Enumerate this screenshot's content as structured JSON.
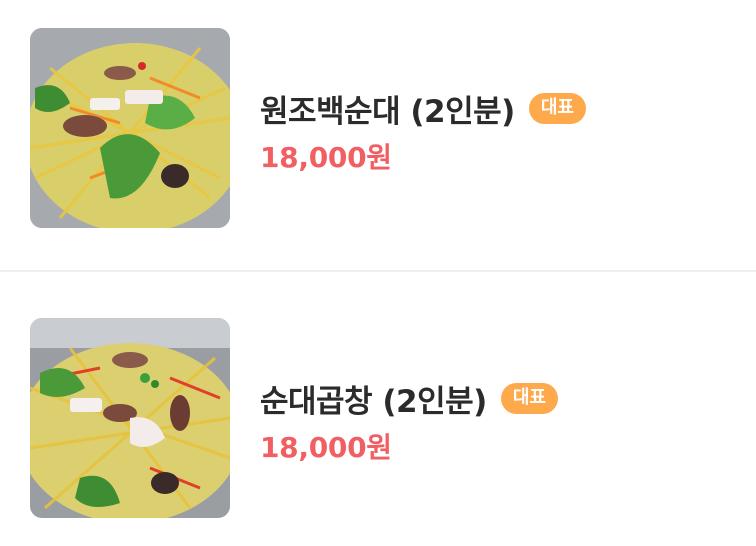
{
  "menu": {
    "items": [
      {
        "name": "원조백순대 (2인분)",
        "badge": "대표",
        "price": "18,000원",
        "image": "sundae-dish-photo"
      },
      {
        "name": "순대곱창 (2인분)",
        "badge": "대표",
        "price": "18,000원",
        "image": "sundae-gopchang-dish-photo"
      }
    ]
  },
  "colors": {
    "price": "#f25f62",
    "badge_bg": "#ffa94d",
    "name_text": "#2b2b2b",
    "divider": "#eeeeee"
  }
}
